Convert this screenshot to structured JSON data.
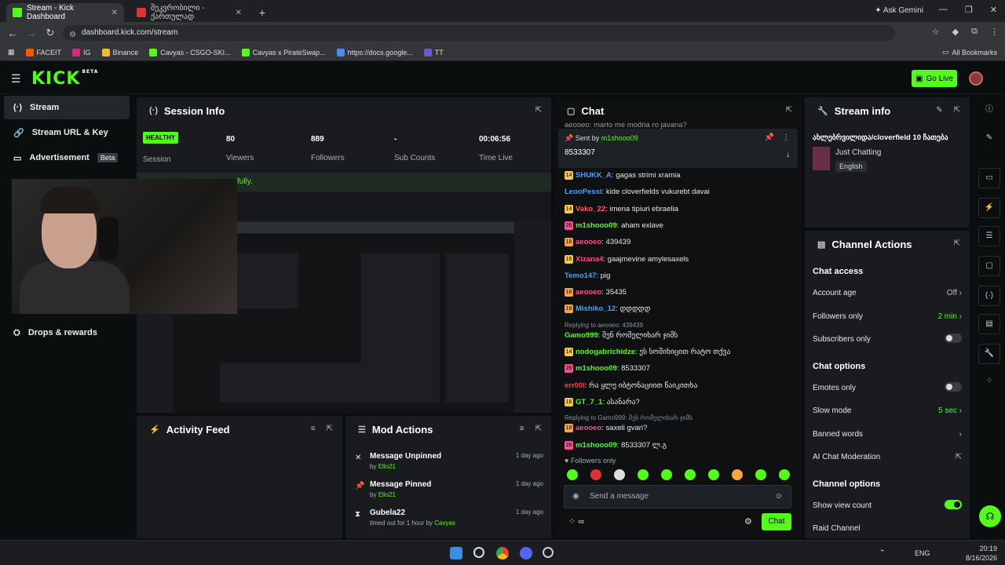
{
  "browser": {
    "tabs": [
      {
        "title": "Stream - Kick Dashboard",
        "active": true
      },
      {
        "title": "შეკვრობილი - ქართულად",
        "active": false
      }
    ],
    "url": "dashboard.kick.com/stream",
    "gemini": "Ask Gemini",
    "bookmarks": [
      "FACEIT",
      "IG",
      "Binance",
      "Cavyas - CSGO-SKI...",
      "Cavyas x PirateSwap...",
      "https://docs.google...",
      "TT"
    ],
    "all_bookmarks": "All Bookmarks"
  },
  "header": {
    "logo": "KICK",
    "logo_sup": "BETA",
    "go_live": "Go Live"
  },
  "sidebar": {
    "items": [
      {
        "label": "Stream"
      },
      {
        "label": "Stream URL & Key"
      },
      {
        "label": "Advertisement",
        "badge": "Beta"
      },
      {
        "label": "Drops & rewards"
      }
    ]
  },
  "session": {
    "title": "Session Info",
    "status": "HEALTHY",
    "status_label": "Session",
    "stats": [
      {
        "value": "80",
        "label": "Viewers"
      },
      {
        "value": "889",
        "label": "Followers"
      },
      {
        "value": "-",
        "label": "Sub Counts"
      },
      {
        "value": "00:06:56",
        "label": "Time Live"
      }
    ],
    "banner": "fully."
  },
  "activity": {
    "title": "Activity Feed"
  },
  "mod_actions": {
    "title": "Mod Actions",
    "items": [
      {
        "title": "Message Unpinned",
        "by": "by",
        "user": "Ello21",
        "date": "1 day ago"
      },
      {
        "title": "Message Pinned",
        "by": "by",
        "user": "Ello21",
        "date": "1 day ago"
      },
      {
        "title": "Gubela22",
        "by": "timed out for 1 hour by",
        "user": "Cavyas",
        "date": "1 day ago"
      }
    ]
  },
  "chat": {
    "title": "Chat",
    "top_partial": "aeooeo: marto me modria ro javana?",
    "pinned": {
      "label": "Sent by",
      "user": "m1shooo09",
      "message": "8533307"
    },
    "messages": [
      {
        "user": "SHUKK_A",
        "color": "#4a9eff",
        "badge": "14",
        "text": "gagas strimi xramia"
      },
      {
        "user": "LeooPessi",
        "color": "#4a9eff",
        "badge": "",
        "text": "kide cloverfields vukurebt davai"
      },
      {
        "user": "Vako_22",
        "color": "#ff5a6a",
        "badge": "14",
        "text": "imena tipiuri ebraelia"
      },
      {
        "user": "m1shooo09",
        "color": "#53fc18",
        "badge": "26",
        "text": "aham exlave"
      },
      {
        "user": "aeooeo",
        "color": "#ff4d8d",
        "badge": "18",
        "text": "439439"
      },
      {
        "user": "Xizana4",
        "color": "#ff4d8d",
        "badge": "16",
        "text": "gaajmevine amylesaxels"
      },
      {
        "user": "Temo147",
        "color": "#4a9eff",
        "badge": "",
        "text": "pig"
      },
      {
        "user": "aeooeo",
        "color": "#ff4d8d",
        "badge": "18",
        "text": "35435"
      },
      {
        "user": "Mishiko_12",
        "color": "#4a9eff",
        "badge": "18",
        "text": "დდდდდ"
      },
      {
        "reply": "Replying to aeooeo: 439439",
        "user": "Gamo999",
        "color": "#53fc18",
        "badge": "",
        "text": "შენ რომელიხარ ჯიმს"
      },
      {
        "user": "nodogabrichidze",
        "color": "#53fc18",
        "badge": "14",
        "text": "ეს სოშიხიცით რატო თქვა"
      },
      {
        "user": "m1shooo09",
        "color": "#53fc18",
        "badge": "26",
        "text": "8533307"
      },
      {
        "user": "err00l",
        "color": "#ff3b3b",
        "badge": "",
        "text": "რა ყლე იბტონაციით წაიკითხა"
      },
      {
        "user": "GT_7_1",
        "color": "#53fc18",
        "badge": "16",
        "text": "ასანარა?"
      },
      {
        "reply": "Replying to Gamo999: შენ რომელიხარ ჯიმს",
        "user": "aeooeo",
        "color": "#ff4d8d",
        "badge": "18",
        "text": "saxeli gvari?"
      },
      {
        "user": "m1shooo09",
        "color": "#53fc18",
        "badge": "26",
        "text": "8533307 ლ.გ"
      }
    ],
    "followers_only": "Followers only",
    "placeholder": "Send a message",
    "send": "Chat",
    "infinity": "∞"
  },
  "stream_info": {
    "title": "Stream info",
    "stream_title": "ახლებრვილიდა/cloverfield 10 ჩათება",
    "category": "Just Chatting",
    "language": "English"
  },
  "channel_actions": {
    "title": "Channel Actions",
    "chat_access": "Chat access",
    "account_age": {
      "label": "Account age",
      "value": "Off"
    },
    "followers_only": {
      "label": "Followers only",
      "value": "2 min"
    },
    "subscribers_only": {
      "label": "Subscribers only",
      "on": false
    },
    "chat_options": "Chat options",
    "emotes_only": {
      "label": "Emotes only",
      "on": false
    },
    "slow_mode": {
      "label": "Slow mode",
      "value": "5 sec"
    },
    "banned_words": "Banned words",
    "ai_moderation": "AI Chat Moderation",
    "channel_options": "Channel options",
    "show_view_count": {
      "label": "Show view count",
      "on": true
    },
    "raid": "Raid Channel"
  },
  "taskbar": {
    "lang": "ENG",
    "time": "20:19",
    "date": "8/16/2026"
  },
  "colors": {
    "accent": "#53fc18",
    "bg": "#0b0e0f",
    "panel": "#191b1f"
  }
}
